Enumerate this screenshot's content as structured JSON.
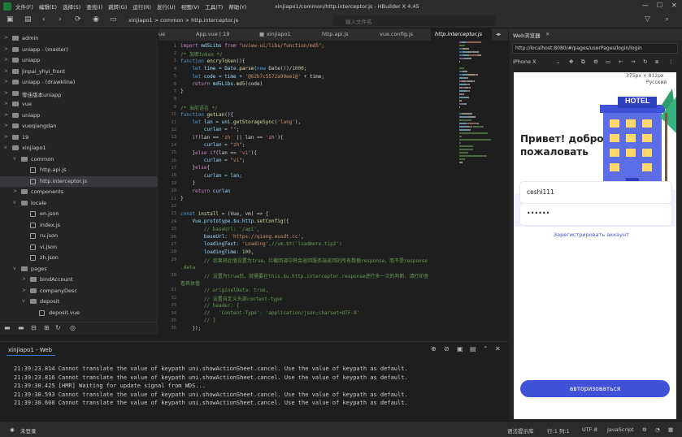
{
  "app": {
    "title": "xinjiapo1/common/http.interceptor.js - HBuilder X 4.45",
    "menu": [
      "文件(F)",
      "编辑(E)",
      "选择(S)",
      "查找(I)",
      "跳转(G)",
      "运行(R)",
      "发行(U)",
      "视图(V)",
      "工具(T)",
      "帮助(Y)"
    ]
  },
  "toolbar": {
    "breadcrumb": [
      "xinjiapo1",
      ">",
      "common",
      ">",
      "http.interceptor.js"
    ],
    "search_placeholder": "输入文件名"
  },
  "sidebar": {
    "items": [
      {
        "label": "admin",
        "indent": 0,
        "icon": "project",
        "tw": ">",
        "sel": false
      },
      {
        "label": "uniapp - (master)",
        "indent": 0,
        "icon": "project",
        "tw": ">",
        "sel": false
      },
      {
        "label": "uniapp",
        "indent": 0,
        "icon": "project",
        "tw": ">",
        "sel": false
      },
      {
        "label": "jinpai_yhyi_front",
        "indent": 0,
        "icon": "project",
        "tw": ">",
        "sel": false
      },
      {
        "label": "uniapp - (drawkline)",
        "indent": 0,
        "icon": "project",
        "tw": ">",
        "sel": false
      },
      {
        "label": "零佳版本uniapp",
        "indent": 0,
        "icon": "project",
        "tw": ">",
        "sel": false
      },
      {
        "label": "vue",
        "indent": 0,
        "icon": "project",
        "tw": ">",
        "sel": false
      },
      {
        "label": "uniapp",
        "indent": 0,
        "icon": "project",
        "tw": ">",
        "sel": false
      },
      {
        "label": "vueqiangdan",
        "indent": 0,
        "icon": "project",
        "tw": ">",
        "sel": false
      },
      {
        "label": "19",
        "indent": 0,
        "icon": "project",
        "tw": ">",
        "sel": false
      },
      {
        "label": "xinjiapo1",
        "indent": 0,
        "icon": "project",
        "tw": "v",
        "sel": false
      },
      {
        "label": "common",
        "indent": 1,
        "icon": "folder",
        "tw": "v",
        "sel": false
      },
      {
        "label": "http.api.js",
        "indent": 2,
        "icon": "file",
        "tw": "",
        "sel": false
      },
      {
        "label": "http.interceptor.js",
        "indent": 2,
        "icon": "file",
        "tw": "",
        "sel": true
      },
      {
        "label": "components",
        "indent": 1,
        "icon": "folder",
        "tw": ">",
        "sel": false
      },
      {
        "label": "locale",
        "indent": 1,
        "icon": "folder",
        "tw": "v",
        "sel": false
      },
      {
        "label": "en.json",
        "indent": 2,
        "icon": "file",
        "tw": "",
        "sel": false
      },
      {
        "label": "index.js",
        "indent": 2,
        "icon": "file",
        "tw": "",
        "sel": false
      },
      {
        "label": "ru.json",
        "indent": 2,
        "icon": "file",
        "tw": "",
        "sel": false
      },
      {
        "label": "vi.json",
        "indent": 2,
        "icon": "file",
        "tw": "",
        "sel": false
      },
      {
        "label": "zh.json",
        "indent": 2,
        "icon": "file",
        "tw": "",
        "sel": false
      },
      {
        "label": "pages",
        "indent": 1,
        "icon": "folder",
        "tw": "v",
        "sel": false
      },
      {
        "label": "bindAccount",
        "indent": 2,
        "icon": "folder",
        "tw": ">",
        "sel": false
      },
      {
        "label": "companyDesc",
        "indent": 2,
        "icon": "folder",
        "tw": ">",
        "sel": false
      },
      {
        "label": "deposit",
        "indent": 2,
        "icon": "folder",
        "tw": "v",
        "sel": false
      },
      {
        "label": "deposit.vue",
        "indent": 3,
        "icon": "file",
        "tw": "",
        "sel": false
      }
    ]
  },
  "editor": {
    "tabs": [
      "ue",
      "App.vue | 19",
      "xinjiapo1",
      "http.api.js",
      "vue.config.js",
      "http.interceptor.js"
    ],
    "lines": [
      {
        "n": "1",
        "segs": [
          [
            "import",
            "#c586c0"
          ],
          [
            " md5Libs ",
            "#9cdcfe"
          ],
          [
            "from",
            "#c586c0"
          ],
          [
            " \"uview-ui/libs/function/md5\";",
            "#ce9178"
          ]
        ]
      },
      {
        "n": "2",
        "segs": [
          [
            "/* 加密token */",
            "#6a9955"
          ]
        ]
      },
      {
        "n": "3",
        "segs": [
          [
            "function",
            "#569cd6"
          ],
          [
            " encryToken",
            "#dcdcaa"
          ],
          [
            "(){",
            "#d4d4d4"
          ]
        ]
      },
      {
        "n": "4",
        "segs": [
          [
            "    let ",
            "#569cd6"
          ],
          [
            "time = Date.",
            "#9cdcfe"
          ],
          [
            "parse",
            "#dcdcaa"
          ],
          [
            "(",
            "#d4d4d4"
          ],
          [
            "new",
            "#569cd6"
          ],
          [
            " Date())/",
            "#d4d4d4"
          ],
          [
            "1000",
            "#b5cea8"
          ],
          [
            ";",
            "#d4d4d4"
          ]
        ]
      },
      {
        "n": "5",
        "segs": [
          [
            "    let ",
            "#569cd6"
          ],
          [
            "code = time + ",
            "#9cdcfe"
          ],
          [
            "'@62b7c5572a99ee1@'",
            "#ce9178"
          ],
          [
            " + time;",
            "#d4d4d4"
          ]
        ]
      },
      {
        "n": "6",
        "segs": [
          [
            "    return ",
            "#c586c0"
          ],
          [
            "md5Libs.",
            "#9cdcfe"
          ],
          [
            "md5",
            "#dcdcaa"
          ],
          [
            "(code)",
            "#d4d4d4"
          ]
        ]
      },
      {
        "n": "7",
        "segs": [
          [
            "}",
            "#d4d4d4"
          ]
        ]
      },
      {
        "n": "8",
        "segs": [
          [
            "",
            "#d4d4d4"
          ]
        ]
      },
      {
        "n": "9",
        "segs": [
          [
            "/* 当前语言 */",
            "#6a9955"
          ]
        ]
      },
      {
        "n": "10",
        "segs": [
          [
            "function",
            "#569cd6"
          ],
          [
            " getLan",
            "#dcdcaa"
          ],
          [
            "(){",
            "#d4d4d4"
          ]
        ]
      },
      {
        "n": "11",
        "segs": [
          [
            "    let ",
            "#569cd6"
          ],
          [
            "lan = uni.",
            "#9cdcfe"
          ],
          [
            "getStorageSync",
            "#dcdcaa"
          ],
          [
            "(",
            "#d4d4d4"
          ],
          [
            "'lang'",
            "#ce9178"
          ],
          [
            "),",
            "#d4d4d4"
          ]
        ]
      },
      {
        "n": "12",
        "segs": [
          [
            "        curlan = ",
            "#9cdcfe"
          ],
          [
            "\"\"",
            "#ce9178"
          ],
          [
            ";",
            "#d4d4d4"
          ]
        ]
      },
      {
        "n": "13",
        "segs": [
          [
            "    if",
            "#c586c0"
          ],
          [
            "(lan == ",
            "#d4d4d4"
          ],
          [
            "'zh'",
            "#ce9178"
          ],
          [
            " || lan == ",
            "#d4d4d4"
          ],
          [
            "'zh'",
            "#ce9178"
          ],
          [
            "){",
            "#d4d4d4"
          ]
        ]
      },
      {
        "n": "14",
        "segs": [
          [
            "        curlan = ",
            "#9cdcfe"
          ],
          [
            "\"zh\"",
            "#ce9178"
          ],
          [
            ";",
            "#d4d4d4"
          ]
        ]
      },
      {
        "n": "15",
        "segs": [
          [
            "    }",
            "#d4d4d4"
          ],
          [
            "else if",
            "#c586c0"
          ],
          [
            "(lan == ",
            "#d4d4d4"
          ],
          [
            "'vi'",
            "#ce9178"
          ],
          [
            "){",
            "#d4d4d4"
          ]
        ]
      },
      {
        "n": "16",
        "segs": [
          [
            "        curlan = ",
            "#9cdcfe"
          ],
          [
            "\"vi\"",
            "#ce9178"
          ],
          [
            ";",
            "#d4d4d4"
          ]
        ]
      },
      {
        "n": "17",
        "segs": [
          [
            "    }",
            "#d4d4d4"
          ],
          [
            "else",
            "#c586c0"
          ],
          [
            "{",
            "#d4d4d4"
          ]
        ]
      },
      {
        "n": "18",
        "segs": [
          [
            "        curlan = lan;",
            "#9cdcfe"
          ]
        ]
      },
      {
        "n": "19",
        "segs": [
          [
            "    }",
            "#d4d4d4"
          ]
        ]
      },
      {
        "n": "20",
        "segs": [
          [
            "    return ",
            "#c586c0"
          ],
          [
            "curlan",
            "#9cdcfe"
          ]
        ]
      },
      {
        "n": "21",
        "segs": [
          [
            "}",
            "#d4d4d4"
          ]
        ]
      },
      {
        "n": "22",
        "segs": [
          [
            "",
            "#d4d4d4"
          ]
        ]
      },
      {
        "n": "23",
        "segs": [
          [
            "const ",
            "#569cd6"
          ],
          [
            "install",
            "#dcdcaa"
          ],
          [
            " = (Vue, vm) => {",
            "#d4d4d4"
          ]
        ]
      },
      {
        "n": "24",
        "segs": [
          [
            "    Vue.prototype.$u.http.",
            "#9cdcfe"
          ],
          [
            "setConfig",
            "#dcdcaa"
          ],
          [
            "({",
            "#d4d4d4"
          ]
        ]
      },
      {
        "n": "25",
        "segs": [
          [
            "        // baseUrl: '/api',",
            "#6a9955"
          ]
        ]
      },
      {
        "n": "26",
        "segs": [
          [
            "        baseUrl: ",
            "#9cdcfe"
          ],
          [
            "'https://qiang.eusdt.cc'",
            "#ce9178"
          ],
          [
            ",",
            "#d4d4d4"
          ]
        ]
      },
      {
        "n": "27",
        "segs": [
          [
            "        loadingText: ",
            "#9cdcfe"
          ],
          [
            "'Loading'",
            "#ce9178"
          ],
          [
            ",//vm.$t('loadmore.tip2')",
            "#6a9955"
          ]
        ]
      },
      {
        "n": "28",
        "segs": [
          [
            "        loadingTime: ",
            "#9cdcfe"
          ],
          [
            "100",
            "#b5cea8"
          ],
          [
            ",",
            "#d4d4d4"
          ]
        ]
      },
      {
        "n": "29",
        "segs": [
          [
            "        // 如果将此值设置为true，拦截回调中将会返回服务端返回的所有数据response，而不是response",
            "#6a9955"
          ]
        ]
      },
      {
        "n": "",
        "segs": [
          [
            ".data",
            "#6a9955"
          ]
        ]
      },
      {
        "n": "30",
        "segs": [
          [
            "        // 设置为true后，就需要在this.$u.http.interceptor.response进行多一次的判断，请打印查",
            "#6a9955"
          ]
        ]
      },
      {
        "n": "",
        "segs": [
          [
            "看具体值",
            "#6a9955"
          ]
        ]
      },
      {
        "n": "31",
        "segs": [
          [
            "        // originalData: true,",
            "#6a9955"
          ]
        ]
      },
      {
        "n": "32",
        "segs": [
          [
            "        // 设置自定义头部content-type",
            "#6a9955"
          ]
        ]
      },
      {
        "n": "33",
        "segs": [
          [
            "        // header: {",
            "#6a9955"
          ]
        ]
      },
      {
        "n": "34",
        "segs": [
          [
            "        //   'Content-Type': 'application/json;charset=UTF-8'",
            "#6a9955"
          ]
        ]
      },
      {
        "n": "35",
        "segs": [
          [
            "        // }",
            "#6a9955"
          ]
        ]
      },
      {
        "n": "36",
        "segs": [
          [
            "    });",
            "#d4d4d4"
          ]
        ]
      }
    ]
  },
  "panel": {
    "title": "xinjiapo1 - Web",
    "lines": [
      "21:39:23.814 Cannot translate the value of keypath uni.showActionSheet.cancel. Use the value of keypath as default.",
      "21:39:23.816 Cannot translate the value of keypath uni.showActionSheet.cancel. Use the value of keypath as default.",
      "21:39:30.425 [HMR] Waiting for update signal from WDS...",
      "21:39:30.593 Cannot translate the value of keypath uni.showActionSheet.cancel. Use the value of keypath as default.",
      "21:39:30.608 Cannot translate the value of keypath uni.showActionSheet.cancel. Use the value of keypath as default."
    ]
  },
  "browser": {
    "tab": "Web浏览器",
    "url": "http://localhost:8080/#/pages/userPages/login/login",
    "device": "iPhone X",
    "size": "375px × 812px",
    "login": {
      "lang": "Русский",
      "hotel": "HOTEL",
      "greeting1": "Привет! добро",
      "greeting2": "пожаловать",
      "username": "ceshi111",
      "password": "••••••",
      "register": "Зарегистрировать аккаунт",
      "button": "авторизоваться"
    }
  },
  "status": {
    "login": "未登录",
    "hint": "语法提示库",
    "position": "行:1  列:1",
    "encoding": "UTF-8",
    "lang": "JavaScript"
  }
}
